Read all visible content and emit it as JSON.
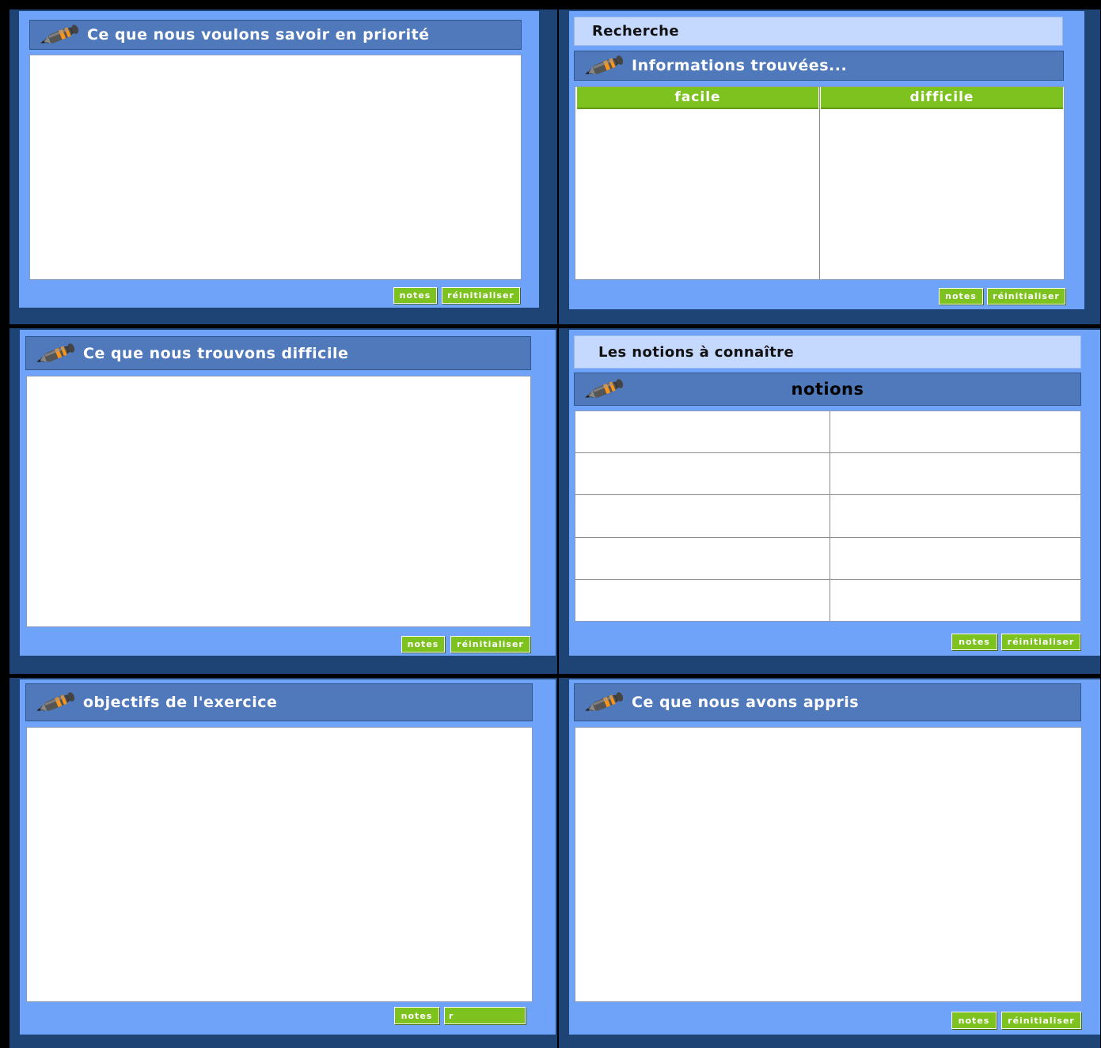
{
  "panels": {
    "priority": {
      "title": "Ce que nous voulons savoir en priorité",
      "notes": "notes",
      "reset": "réinitialiser"
    },
    "research": {
      "section": "Recherche",
      "title": "Informations trouvées...",
      "columns": [
        "facile",
        "difficile"
      ],
      "notes": "notes",
      "reset": "réinitialiser"
    },
    "difficult": {
      "title": "Ce que nous trouvons difficile",
      "notes": "notes",
      "reset": "réinitialiser"
    },
    "notions": {
      "section": "Les notions à connaître",
      "title": "notions",
      "notes": "notes",
      "reset": "réinitialiser"
    },
    "objectives": {
      "title": "objectifs de l'exercice",
      "notes": "notes",
      "reset": "r"
    },
    "learned": {
      "title": "Ce que nous avons appris",
      "notes": "notes",
      "reset": "réinitialiser"
    }
  },
  "colors": {
    "frame": "#1e4475",
    "panel_bg": "#6ea3f9",
    "header_bg": "#5079bb",
    "section_bg": "#c5d8fd",
    "button_green": "#7dc21e"
  },
  "icons": {
    "header": "pen-icon"
  }
}
